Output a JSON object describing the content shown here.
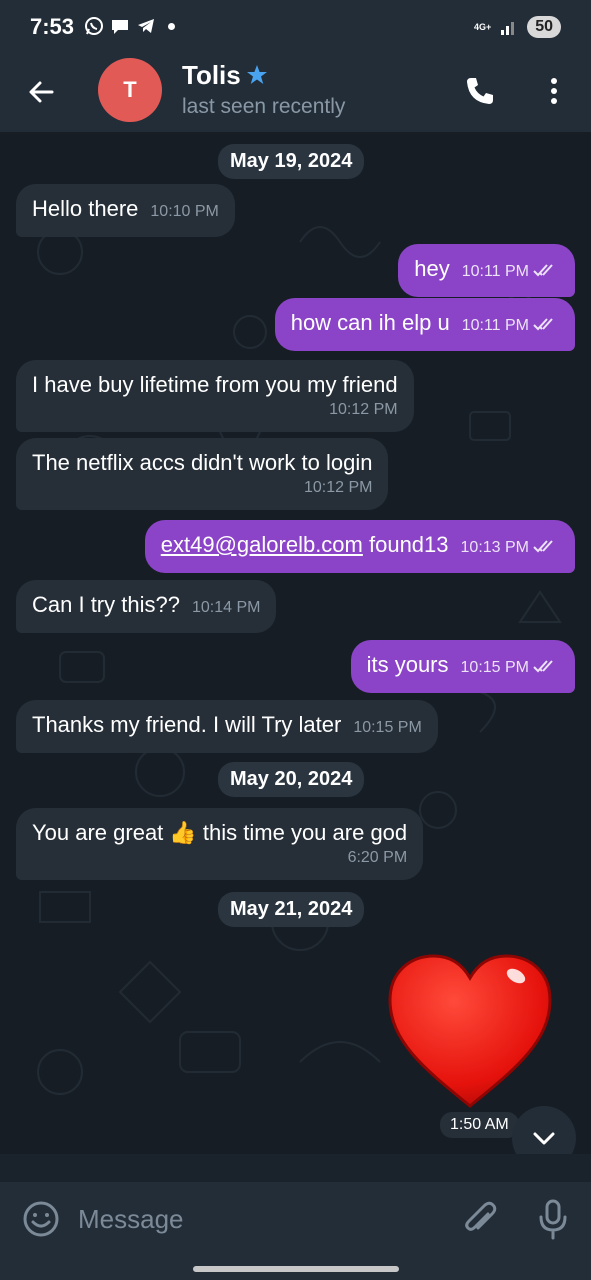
{
  "status_bar": {
    "time": "7:53",
    "network": "4G+",
    "battery": "50"
  },
  "header": {
    "avatar_letter": "T",
    "name": "Tolis",
    "status": "last seen recently"
  },
  "messages": [
    {
      "type": "date",
      "text": "May 19, 2024"
    },
    {
      "type": "in",
      "text": "Hello there",
      "time": "10:10 PM"
    },
    {
      "type": "out",
      "text": "hey",
      "time": "10:11 PM"
    },
    {
      "type": "out",
      "text": "how can ih elp u",
      "time": "10:11 PM"
    },
    {
      "type": "in",
      "text": "I have buy lifetime from you my friend",
      "time": "10:12 PM"
    },
    {
      "type": "in",
      "text": "The netflix accs didn't work to login",
      "time": "10:12 PM"
    },
    {
      "type": "out",
      "link": "ext49@galorelb.com",
      "text": " found13",
      "time": "10:13 PM"
    },
    {
      "type": "in",
      "text": "Can I try this??",
      "time": "10:14 PM"
    },
    {
      "type": "out",
      "text": "its yours",
      "time": "10:15 PM"
    },
    {
      "type": "in",
      "text": "Thanks my friend.  I will Try later",
      "time": "10:15 PM"
    },
    {
      "type": "date",
      "text": "May 20, 2024"
    },
    {
      "type": "in",
      "text_before": "You are great ",
      "emoji": "👍",
      "text_after": " this time you are god",
      "time": "6:20 PM"
    },
    {
      "type": "date",
      "text": "May 21, 2024"
    },
    {
      "type": "sticker",
      "name": "red-heart",
      "time": "1:50 AM"
    }
  ],
  "input": {
    "placeholder": "Message"
  },
  "colors": {
    "outgoing_bubble": "#8b44c7",
    "incoming_bubble": "#262f38",
    "header_bg": "#222d38",
    "chat_bg": "#161d25",
    "avatar": "#e25a56",
    "verified_star": "#4aa3ef"
  }
}
